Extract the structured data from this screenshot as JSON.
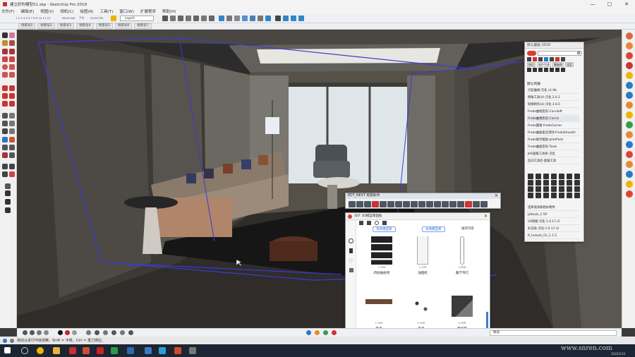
{
  "window": {
    "title": "建立好的模型01.skp - SketchUp Pro 2019",
    "controls": [
      "—",
      "▢",
      "✕"
    ]
  },
  "menu": [
    "文件(F)",
    "编辑(E)",
    "视图(V)",
    "相机(C)",
    "绘图(R)",
    "工具(T)",
    "窗口(W)",
    "扩展程序",
    "帮助(H)"
  ],
  "toolbar": {
    "scene_numbers": "1 2 3 4 5 6 7 8 9 10 11 12",
    "time_a": "06:00 AM",
    "time_b": "下午",
    "time_c": "05:00 PM",
    "layer": "Layer0"
  },
  "scene_tabs": [
    "场景号1",
    "场景号2",
    "场景号3",
    "场景号4",
    "场景号5",
    "场景号6",
    "场景号7"
  ],
  "tray": {
    "title": "默认面板 2019",
    "tabs": [
      "热点",
      "插件列表",
      "基础库",
      "设定"
    ],
    "section_title": "默认列表",
    "plugins": [
      "贝兹曲线-汉化 v1.0b",
      "倒角工具(4)-汉化 2.0.2",
      "轮廓制作(4)-汉化 3.0.0",
      "Fredo曲线变形-Curviloft",
      "Fredo曲线优化-Curviz",
      "Fredo圆角-FredoCorner",
      "Fredo曲面柔化消除-FredoSmooth",
      "Fredo联合缩放-JointPush",
      "Fredo曲面变形-Tools",
      "JHS超级工具条-汉化",
      "区间工具栏-超级工具"
    ],
    "plugins_lower": [
      "选择或关联相似物件",
      "joitools_1.59",
      "US修图-汉化 1.0.17.r2",
      "彩渲染-汉化-1.0.17.r2",
      "R_Instant_Ch_1.1.5"
    ],
    "selected_index": 4
  },
  "ed_toolbar": {
    "title": "EDT_NEXT 照套助手"
  },
  "library": {
    "title": "SDT 3D模型库面板",
    "tabs": [
      "系统模型库",
      "本地模型库",
      "推荐内容"
    ],
    "items": [
      {
        "name": "四层抽屉柜",
        "size": "1.0MB"
      },
      {
        "name": "油烟机",
        "size": "1.1MB"
      },
      {
        "name": "餐厅吊灯",
        "size": "0.8MB"
      },
      {
        "name": "餐桌",
        "size": "1.2MB"
      },
      {
        "name": "饰品",
        "size": "0.3MB"
      },
      {
        "name": "电视柜",
        "size": "0.9MB"
      }
    ]
  },
  "status": {
    "hint": "拖动以进行环绕观察。Shift = 平移，Ctrl = 重力感应。",
    "measurement_label": "数值"
  },
  "taskbar": {
    "clock": "2020/5/24"
  },
  "watermark": "www.snren.com",
  "colors": {
    "accent": "#3b7be0",
    "selection_blue": "#3b3bd6"
  }
}
